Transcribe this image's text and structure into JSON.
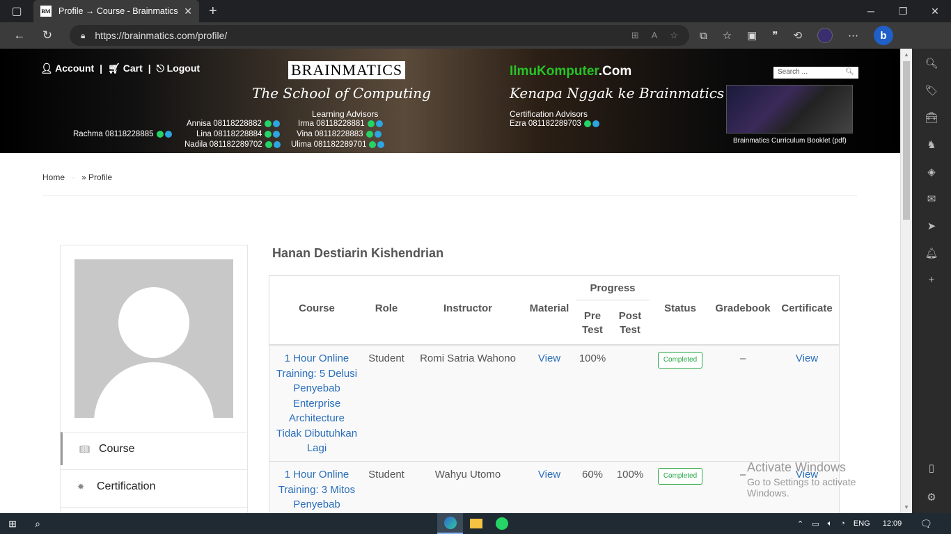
{
  "browser": {
    "tab_title": "Profile → Course - Brainmatics",
    "favicon_text": "BM",
    "url": "https://brainmatics.com/profile/"
  },
  "banner": {
    "account": "Account",
    "cart": "Cart",
    "logout": "Logout",
    "separator": "|",
    "logo": "BRAINMATICS",
    "tagline": "The School of Computing",
    "learning_advisors": "Learning Advisors",
    "certification_advisors": "Certification Advisors",
    "contacts": {
      "rachma": "Rachma  08118228885",
      "annisa": "Annisa  08118228882",
      "lina": "Lina  08118228884",
      "nadila": "Nadila  081182289702",
      "irma": "Irma  08118228881",
      "vina": "Vina  08118228883",
      "ulima": "Ulima  081182289701",
      "ezra": "Ezra  081182289703"
    },
    "ilmu_green": "IlmuKomputer",
    "ilmu_white": ".Com",
    "kenapa": "Kenapa Nggak ke Brainmatics Aja?",
    "search_placeholder": "Search ...",
    "booklet_caption": "Brainmatics Curriculum Booklet (pdf)"
  },
  "breadcrumb": {
    "home": "Home",
    "current": "» Profile"
  },
  "profile": {
    "name": "Hanan Destiarin Kishendrian",
    "menu": [
      {
        "label": "Course"
      },
      {
        "label": "Certification"
      }
    ]
  },
  "table": {
    "headers": {
      "course": "Course",
      "role": "Role",
      "instructor": "Instructor",
      "material": "Material",
      "progress": "Progress",
      "pre_test": "Pre Test",
      "post_test": "Post Test",
      "status": "Status",
      "gradebook": "Gradebook",
      "certificate": "Certificate"
    },
    "rows": [
      {
        "course": "1 Hour Online Training: 5 Delusi Penyebab Enterprise Architecture Tidak Dibutuhkan Lagi",
        "role": "Student",
        "instructor": "Romi Satria Wahono",
        "material": "View",
        "pre_test": "100%",
        "post_test": "",
        "status": "Completed",
        "gradebook": "–",
        "certificate": "View"
      },
      {
        "course": "1 Hour Online Training: 3 Mitos Penyebab",
        "role": "Student",
        "instructor": "Wahyu Utomo",
        "material": "View",
        "pre_test": "60%",
        "post_test": "100%",
        "status": "Completed",
        "gradebook": "–",
        "certificate": "View"
      }
    ]
  },
  "watermark": {
    "line1": "Activate Windows",
    "line2": "Go to Settings to activate Windows."
  },
  "taskbar": {
    "language": "ENG",
    "time": "12:09"
  }
}
